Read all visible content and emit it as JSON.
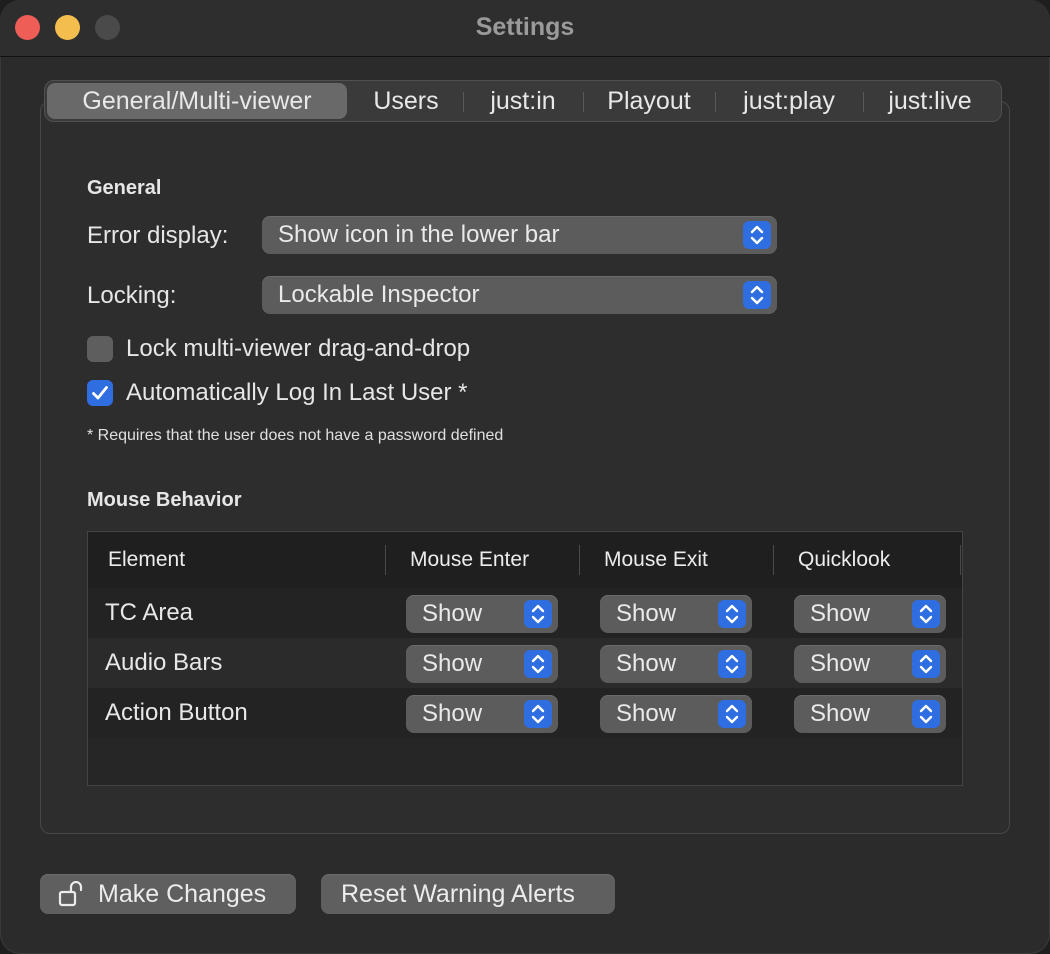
{
  "window": {
    "title": "Settings"
  },
  "tabs": [
    {
      "label": "General/Multi-viewer"
    },
    {
      "label": "Users"
    },
    {
      "label": "just:in"
    },
    {
      "label": "Playout"
    },
    {
      "label": "just:play"
    },
    {
      "label": "just:live"
    }
  ],
  "general": {
    "section_title": "General",
    "error_display_label": "Error display:",
    "error_display_value": "Show icon in the lower bar",
    "locking_label": "Locking:",
    "locking_value": "Lockable Inspector",
    "lock_dragdrop_label": "Lock multi-viewer drag-and-drop",
    "lock_dragdrop_checked": false,
    "auto_login_label": "Automatically Log In Last User *",
    "auto_login_checked": true,
    "footnote": "* Requires that the user does not have a password defined"
  },
  "mouse": {
    "section_title": "Mouse Behavior",
    "columns": [
      "Element",
      "Mouse Enter",
      "Mouse Exit",
      "Quicklook"
    ],
    "rows": [
      {
        "element": "TC Area",
        "enter": "Show",
        "exit": "Show",
        "quicklook": "Show"
      },
      {
        "element": "Audio Bars",
        "enter": "Show",
        "exit": "Show",
        "quicklook": "Show"
      },
      {
        "element": "Action Button",
        "enter": "Show",
        "exit": "Show",
        "quicklook": "Show"
      }
    ]
  },
  "footer": {
    "make_changes_label": "Make Changes",
    "reset_alerts_label": "Reset Warning Alerts"
  },
  "colors": {
    "accent": "#2f6ee0",
    "close": "#ee5e57",
    "minimize": "#f4be4f"
  },
  "icons": {
    "stepper": "up-down-chevron-icon",
    "checkmark": "checkmark-icon",
    "lock": "unlocked-padlock-icon"
  }
}
